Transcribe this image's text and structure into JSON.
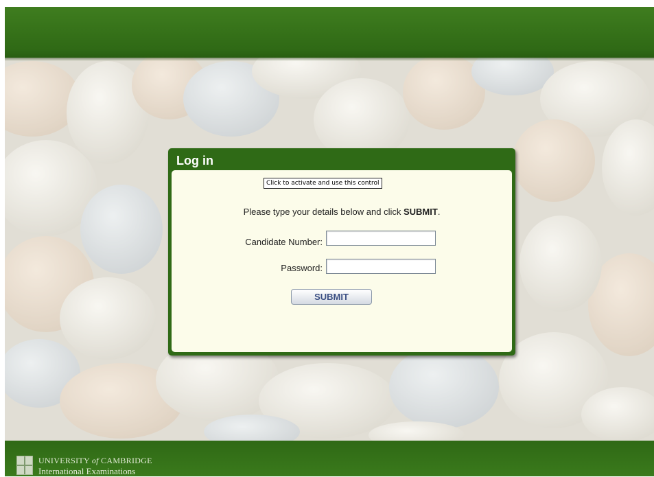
{
  "header": {
    "bar_color": "#2f6915"
  },
  "background": {
    "description_icon": "pebbles-image"
  },
  "login": {
    "title": "Log in",
    "activate_control_text": "Click to activate and use this control",
    "instruction_prefix": "Please type your details below and click ",
    "instruction_bold": "SUBMIT",
    "instruction_suffix": ".",
    "candidate_label": "Candidate Number:",
    "candidate_value": "",
    "password_label": "Password:",
    "password_value": "",
    "submit_label": "SUBMIT"
  },
  "footer": {
    "logo_word1": "UNIVERSITY ",
    "logo_of": "of",
    "logo_word2": " CAMBRIDGE",
    "logo_line2": "International Examinations",
    "logo_icon": "cambridge-crest-icon"
  },
  "colors": {
    "brand_green": "#2f6915",
    "panel_bg": "#fcfcea",
    "submit_text": "#3b4f83"
  }
}
